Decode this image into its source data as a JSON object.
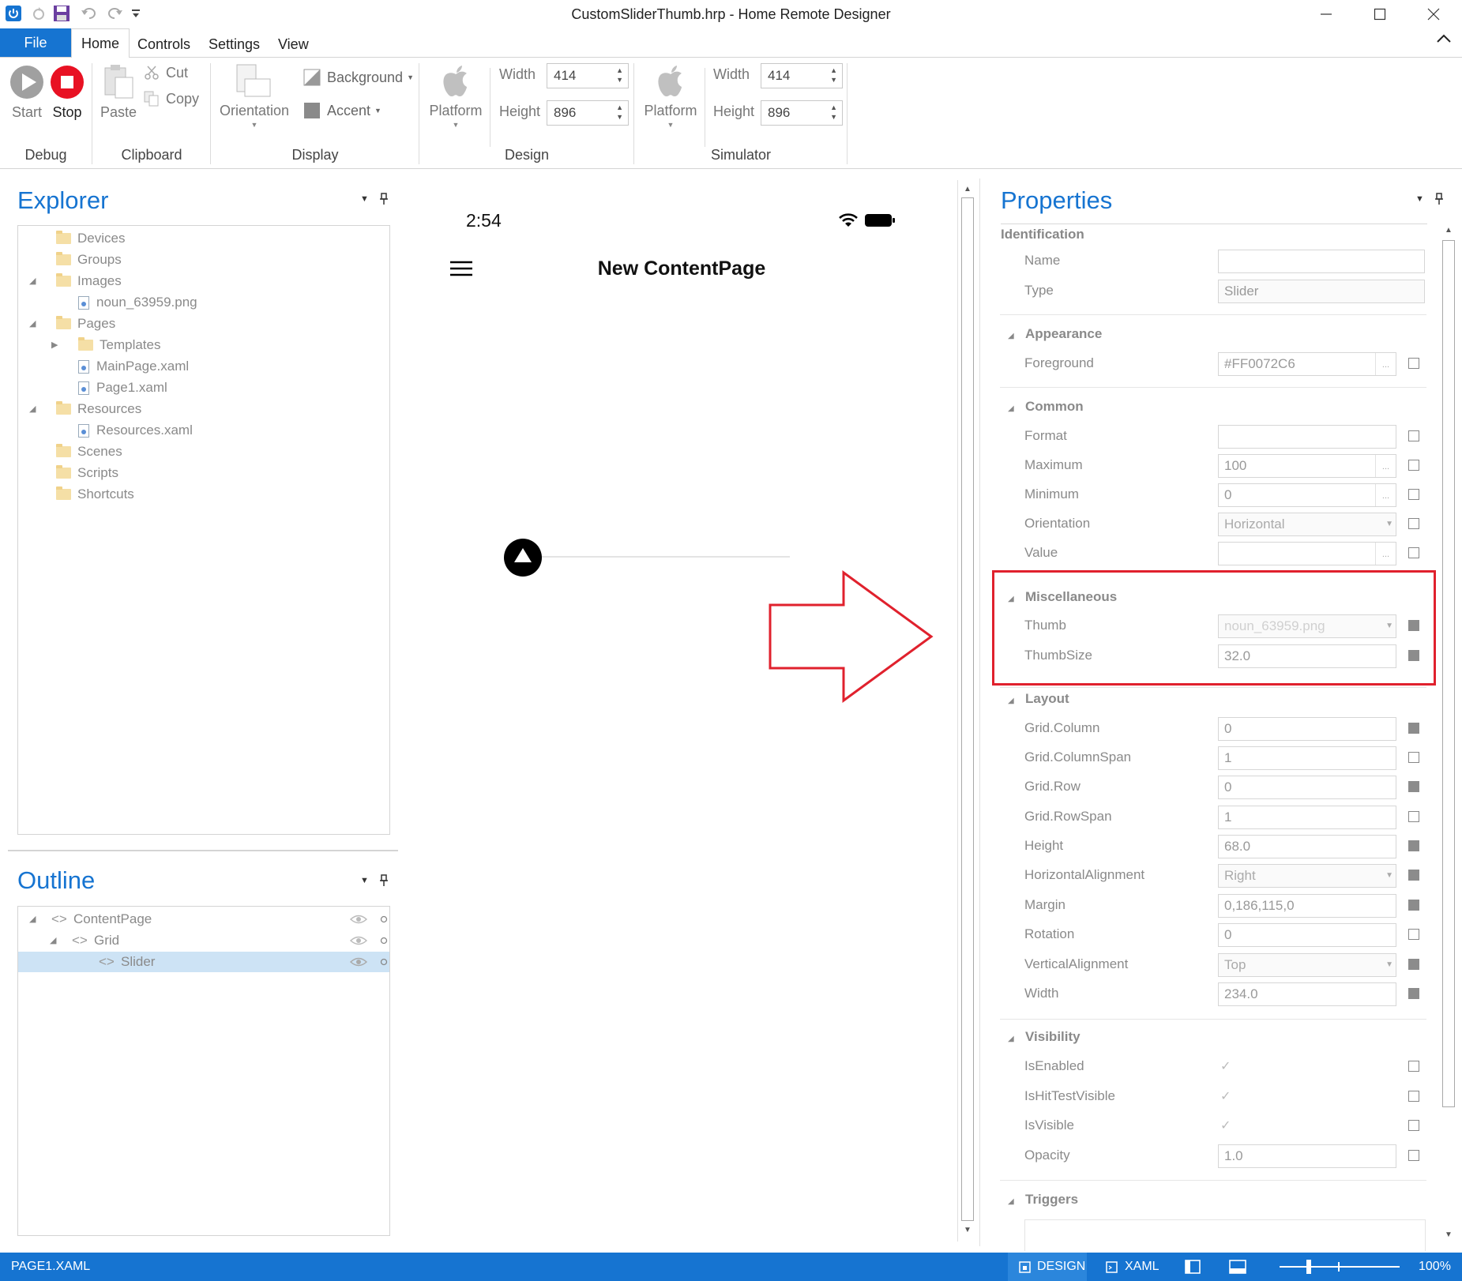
{
  "window": {
    "title": "CustomSliderThumb.hrp - Home Remote Designer"
  },
  "ribbon": {
    "tabs": [
      {
        "label": "File"
      },
      {
        "label": "Home"
      },
      {
        "label": "Controls"
      },
      {
        "label": "Settings"
      },
      {
        "label": "View"
      }
    ],
    "debug": {
      "start_label": "Start",
      "stop_label": "Stop",
      "group_label": "Debug"
    },
    "clipboard": {
      "paste_label": "Paste",
      "cut_label": "Cut",
      "copy_label": "Copy",
      "group_label": "Clipboard"
    },
    "display": {
      "orientation_label": "Orientation",
      "background_label": "Background",
      "accent_label": "Accent",
      "group_label": "Display"
    },
    "design": {
      "platform_label": "Platform",
      "width_label": "Width",
      "width_value": "414",
      "height_label": "Height",
      "height_value": "896",
      "group_label": "Design"
    },
    "simulator": {
      "platform_label": "Platform",
      "width_label": "Width",
      "width_value": "414",
      "height_label": "Height",
      "height_value": "896",
      "group_label": "Simulator"
    }
  },
  "explorer": {
    "title": "Explorer",
    "items": [
      {
        "label": "Devices"
      },
      {
        "label": "Groups"
      },
      {
        "label": "Images"
      },
      {
        "label": "noun_63959.png"
      },
      {
        "label": "Pages"
      },
      {
        "label": "Templates"
      },
      {
        "label": "MainPage.xaml"
      },
      {
        "label": "Page1.xaml"
      },
      {
        "label": "Resources"
      },
      {
        "label": "Resources.xaml"
      },
      {
        "label": "Scenes"
      },
      {
        "label": "Scripts"
      },
      {
        "label": "Shortcuts"
      }
    ]
  },
  "outline": {
    "title": "Outline",
    "items": [
      {
        "label": "ContentPage"
      },
      {
        "label": "Grid"
      },
      {
        "label": "Slider"
      }
    ]
  },
  "canvas": {
    "time": "2:54",
    "page_title": "New ContentPage",
    "slider_value": 0,
    "slider_max": 100
  },
  "properties": {
    "title": "Properties",
    "identification": {
      "label": "Identification",
      "name_label": "Name",
      "name_value": "",
      "type_label": "Type",
      "type_value": "Slider"
    },
    "appearance": {
      "label": "Appearance",
      "foreground_label": "Foreground",
      "foreground_value": "#FF0072C6"
    },
    "common": {
      "label": "Common",
      "format_label": "Format",
      "format_value": "",
      "maximum_label": "Maximum",
      "maximum_value": "100",
      "minimum_label": "Minimum",
      "minimum_value": "0",
      "orientation_label": "Orientation",
      "orientation_value": "Horizontal",
      "value_label": "Value",
      "value_value": ""
    },
    "miscellaneous": {
      "label": "Miscellaneous",
      "thumb_label": "Thumb",
      "thumb_value": "noun_63959.png",
      "thumbsize_label": "ThumbSize",
      "thumbsize_value": "32.0"
    },
    "layout": {
      "label": "Layout",
      "grid_column_label": "Grid.Column",
      "grid_column_value": "0",
      "grid_columnspan_label": "Grid.ColumnSpan",
      "grid_columnspan_value": "1",
      "grid_row_label": "Grid.Row",
      "grid_row_value": "0",
      "grid_rowspan_label": "Grid.RowSpan",
      "grid_rowspan_value": "1",
      "height_label": "Height",
      "height_value": "68.0",
      "halign_label": "HorizontalAlignment",
      "halign_value": "Right",
      "margin_label": "Margin",
      "margin_value": "0,186,115,0",
      "rotation_label": "Rotation",
      "rotation_value": "0",
      "valign_label": "VerticalAlignment",
      "valign_value": "Top",
      "width_label": "Width",
      "width_value": "234.0"
    },
    "visibility": {
      "label": "Visibility",
      "isenabled_label": "IsEnabled",
      "ishittestvisible_label": "IsHitTestVisible",
      "isvisible_label": "IsVisible",
      "opacity_label": "Opacity",
      "opacity_value": "1.0"
    },
    "triggers": {
      "label": "Triggers"
    }
  },
  "statusbar": {
    "file_label": "PAGE1.XAML",
    "design_label": "DESIGN",
    "xaml_label": "XAML",
    "zoom_label": "100%"
  },
  "colors": {
    "accent": "#1674d1",
    "annotation": "#e0212d",
    "stop": "#e81123"
  }
}
